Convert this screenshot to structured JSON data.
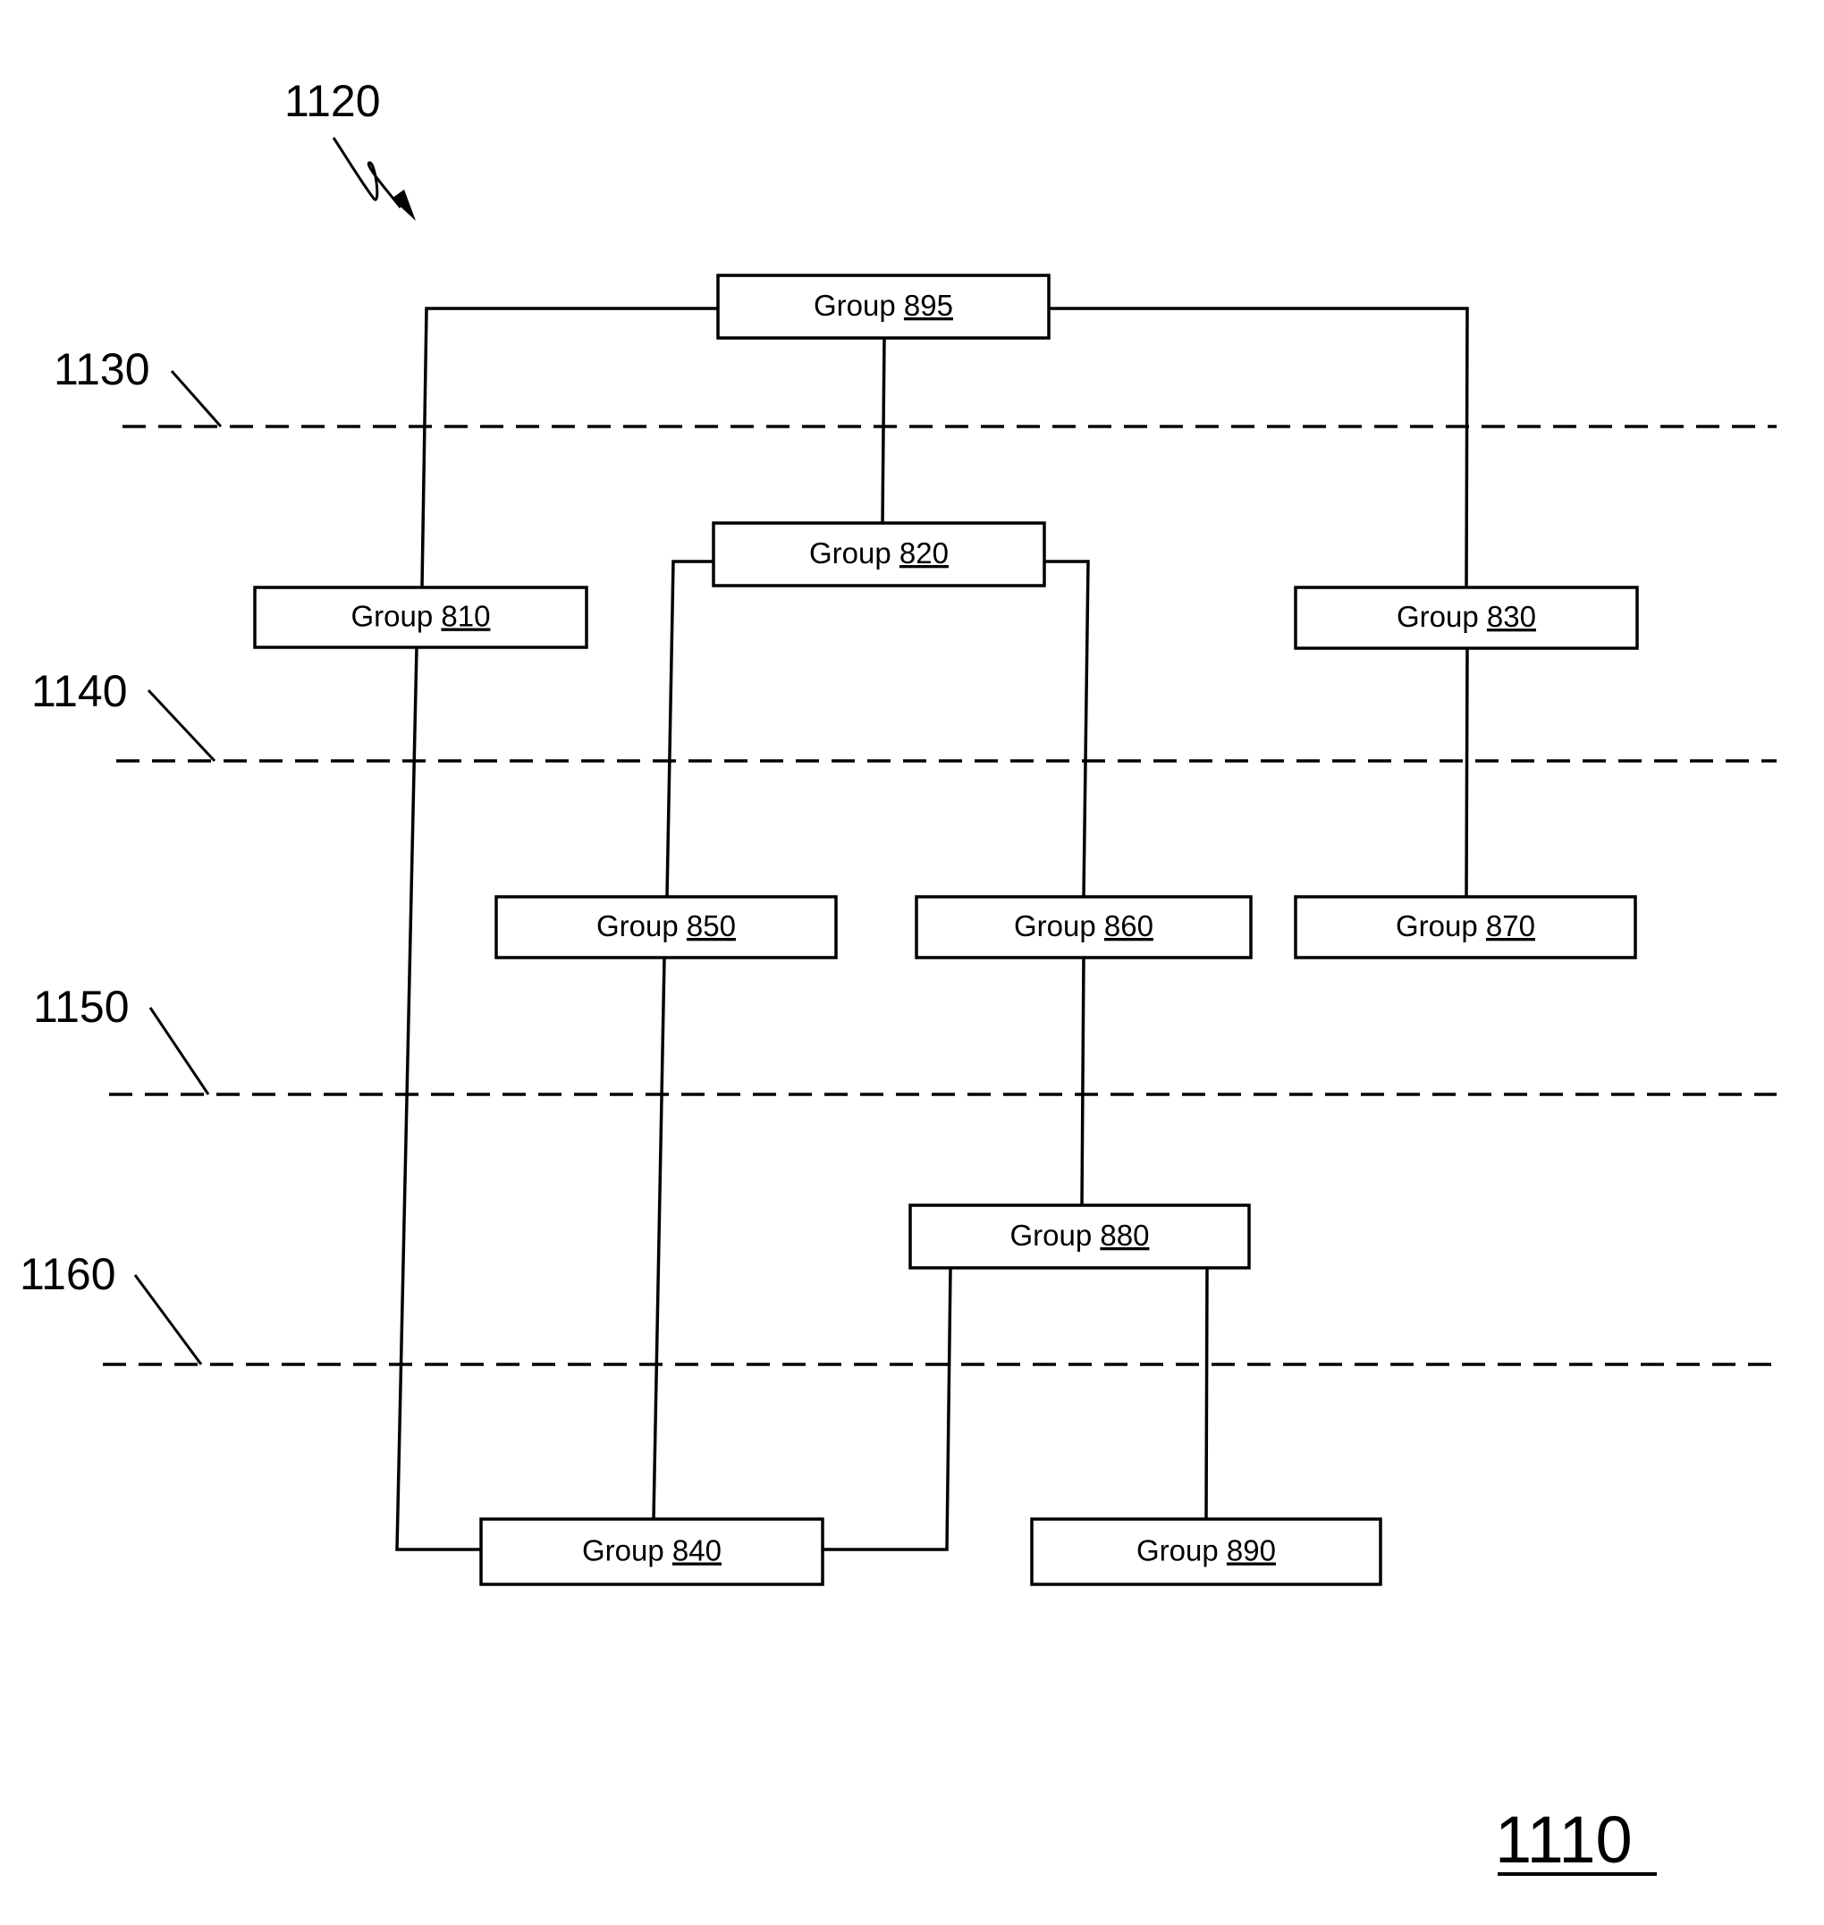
{
  "figure": {
    "reference": "1110",
    "pointer_label": "1120",
    "levels": [
      {
        "id": "level-1130",
        "label": "1130"
      },
      {
        "id": "level-1140",
        "label": "1140"
      },
      {
        "id": "level-1150",
        "label": "1150"
      },
      {
        "id": "level-1160",
        "label": "1160"
      }
    ],
    "groups": [
      {
        "id": "895",
        "prefix": "Group",
        "number": "895"
      },
      {
        "id": "810",
        "prefix": "Group",
        "number": "810"
      },
      {
        "id": "820",
        "prefix": "Group",
        "number": "820"
      },
      {
        "id": "830",
        "prefix": "Group",
        "number": "830"
      },
      {
        "id": "850",
        "prefix": "Group",
        "number": "850"
      },
      {
        "id": "860",
        "prefix": "Group",
        "number": "860"
      },
      {
        "id": "870",
        "prefix": "Group",
        "number": "870"
      },
      {
        "id": "880",
        "prefix": "Group",
        "number": "880"
      },
      {
        "id": "840",
        "prefix": "Group",
        "number": "840"
      },
      {
        "id": "890",
        "prefix": "Group",
        "number": "890"
      }
    ],
    "edges": [
      {
        "from": "895",
        "to": "810"
      },
      {
        "from": "895",
        "to": "820"
      },
      {
        "from": "895",
        "to": "830"
      },
      {
        "from": "820",
        "to": "850"
      },
      {
        "from": "820",
        "to": "860"
      },
      {
        "from": "830",
        "to": "870"
      },
      {
        "from": "860",
        "to": "880"
      },
      {
        "from": "810",
        "to": "840"
      },
      {
        "from": "850",
        "to": "840"
      },
      {
        "from": "880",
        "to": "840"
      },
      {
        "from": "880",
        "to": "890"
      }
    ]
  }
}
